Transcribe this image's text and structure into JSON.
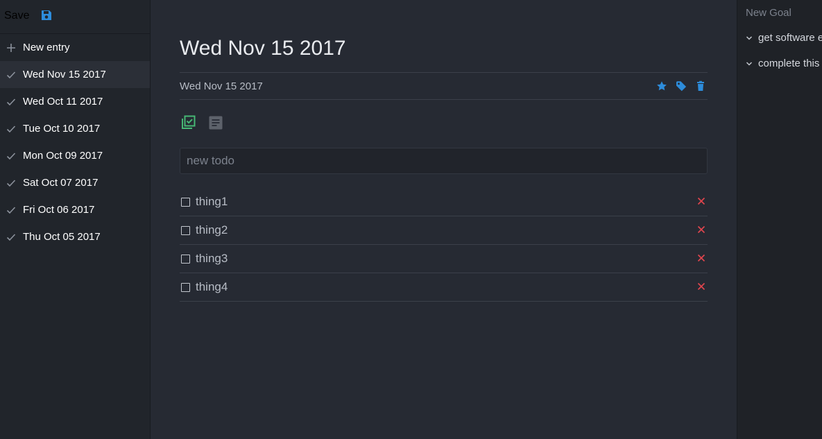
{
  "sidebar": {
    "save_label": "Save",
    "new_entry_label": "New entry",
    "entries": [
      {
        "label": "Wed Nov 15 2017",
        "active": true
      },
      {
        "label": "Wed Oct 11 2017",
        "active": false
      },
      {
        "label": "Tue Oct 10 2017",
        "active": false
      },
      {
        "label": "Mon Oct 09 2017",
        "active": false
      },
      {
        "label": "Sat Oct 07 2017",
        "active": false
      },
      {
        "label": "Fri Oct 06 2017",
        "active": false
      },
      {
        "label": "Thu Oct 05 2017",
        "active": false
      }
    ]
  },
  "main": {
    "title": "Wed Nov 15 2017",
    "date": "Wed Nov 15 2017",
    "new_todo_placeholder": "new todo",
    "todos": [
      {
        "text": "thing1",
        "done": false
      },
      {
        "text": "thing2",
        "done": false
      },
      {
        "text": "thing3",
        "done": false
      },
      {
        "text": "thing4",
        "done": false
      }
    ]
  },
  "goals": {
    "new_goal_placeholder": "New Goal",
    "items": [
      {
        "label": "get software e"
      },
      {
        "label": "complete this"
      }
    ]
  },
  "colors": {
    "accent": "#2d8cdb",
    "todo_mode": "#46b874",
    "delete": "#e0454d"
  }
}
